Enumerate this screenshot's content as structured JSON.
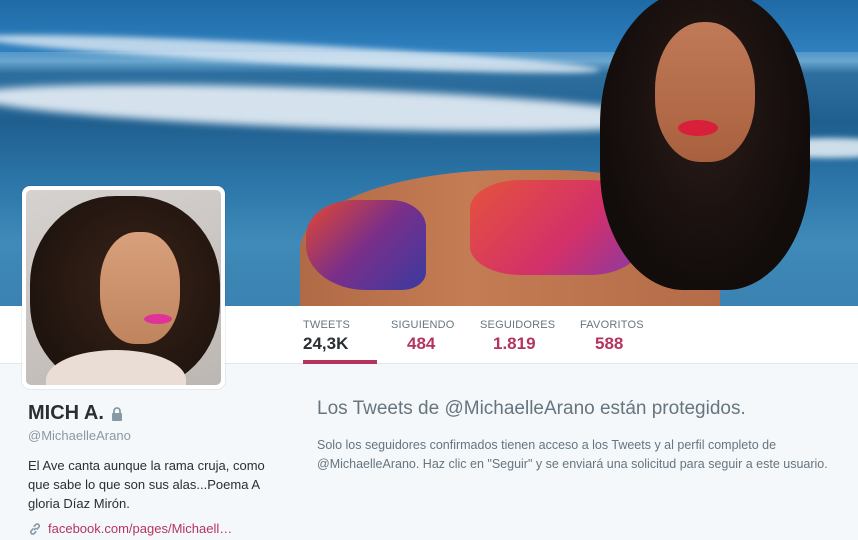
{
  "profile": {
    "name": "MICH A.",
    "handle": "@MichaelleArano",
    "bio": "El Ave canta aunque la rama cruja, como que sabe lo que son sus alas...Poema A gloria Díaz Mirón.",
    "url": "facebook.com/pages/Michaell…",
    "protected_icon": "lock-icon",
    "link_icon": "link-icon"
  },
  "nav": {
    "items": [
      {
        "label": "TWEETS",
        "value": "24,3K"
      },
      {
        "label": "SIGUIENDO",
        "value": "484"
      },
      {
        "label": "SEGUIDORES",
        "value": "1.819"
      },
      {
        "label": "FAVORITOS",
        "value": "588"
      }
    ]
  },
  "protected": {
    "title": "Los Tweets de @MichaelleArano están protegidos.",
    "line1": "Solo los seguidores confirmados tienen acceso a los Tweets y al perfil completo de",
    "line2": "@MichaelleArano. Haz clic en \"Seguir\" y se enviará una solicitud para seguir a este usuario."
  },
  "colors": {
    "accent": "#b5345e",
    "text": "#292f33",
    "muted": "#66757f",
    "background": "#f5f8fa"
  }
}
